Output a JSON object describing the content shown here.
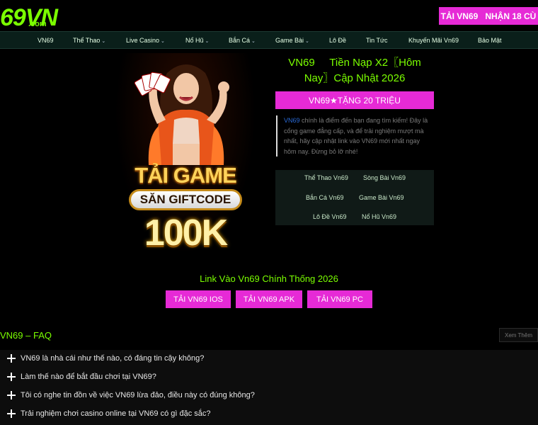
{
  "header": {
    "logo_main": "69VN",
    "logo_sub": ".com",
    "cta_left": "TẢI VN69",
    "cta_right": "NHẬN 18 CÙ"
  },
  "nav": {
    "items": [
      {
        "label": "VN69",
        "has_dropdown": false
      },
      {
        "label": "Thể Thao",
        "has_dropdown": true
      },
      {
        "label": "Live Casino",
        "has_dropdown": true
      },
      {
        "label": "Nổ Hũ",
        "has_dropdown": true
      },
      {
        "label": "Bắn Cá",
        "has_dropdown": true
      },
      {
        "label": "Game Bài",
        "has_dropdown": true
      },
      {
        "label": "Lô Đề",
        "has_dropdown": false
      },
      {
        "label": "Tin Tức",
        "has_dropdown": false
      },
      {
        "label": "Khuyến Mãi Vn69",
        "has_dropdown": false
      },
      {
        "label": "Bảo Mật",
        "has_dropdown": false
      }
    ]
  },
  "hero": {
    "promo_line1": "TẢI GAME",
    "promo_pill": "SĂN GIFTCODE",
    "promo_line2": "100K",
    "title": "VN69     Tiền Nạp X2〖Hôm Nay〗Cập Nhật 2026",
    "button": "VN69★TẶNG 20 TRIỆU",
    "desc_link": "VN69",
    "desc_text": " chính là điểm đến bạn đang tìm kiếm! Đây là cổng game đẳng cấp, và để trải nghiệm mượt mà nhất, hãy cập nhật link vào VN69 mới nhất ngay hôm nay. Đừng bỏ lỡ nhé!",
    "quick_links": [
      "Thể Thao Vn69",
      "Sòng Bài Vn69",
      "Bắn Cá Vn69",
      "Game Bài Vn69",
      "Lô Đề Vn69",
      "Nổ Hũ Vn69"
    ]
  },
  "links_section": {
    "title": "Link Vào Vn69 Chính Thống 2026",
    "buttons": [
      "TẢI VN69 IOS",
      "TẢI VN69 APK",
      "TẢI VN69 PC"
    ]
  },
  "faq": {
    "title": "VN69 – FAQ",
    "see_more": "Xem Thêm",
    "items": [
      "VN69 là nhà cái như thế nào, có đáng tin cậy không?",
      "Làm thế nào để bắt đầu chơi tại VN69?",
      "Tôi có nghe tin đồn về việc VN69 lừa đảo, điều này có đúng không?",
      "Trải nghiệm chơi casino online tại VN69 có gì đặc sắc?"
    ]
  },
  "colors": {
    "accent_green": "#7bff00",
    "accent_pink": "#e62ad6",
    "nav_bg": "#0a1f1a"
  },
  "icons": {
    "dropdown": "chevron-down-icon",
    "faq_expand": "plus-icon"
  }
}
